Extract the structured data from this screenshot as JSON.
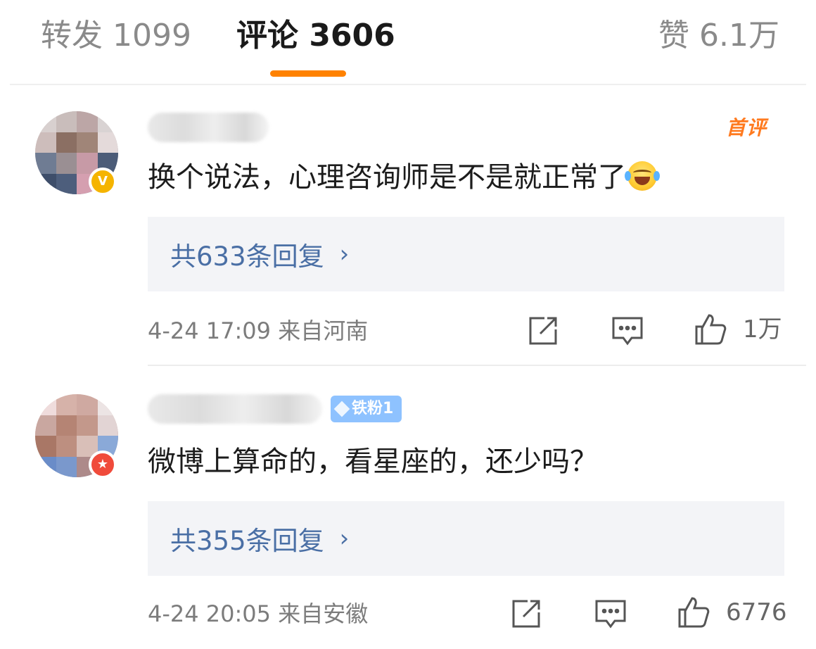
{
  "tabs": {
    "repost": "转发 1099",
    "comment": "评论 3606",
    "like": "赞 6.1万",
    "accent_color": "#ff8200"
  },
  "comments": [
    {
      "badge": "V",
      "tag": "首评",
      "text": "换个说法，心理咨询师是不是就正常了",
      "emoji": "laughing-tears-emoji",
      "replies": "共633条回复",
      "meta": "4-24 17:09 来自河南",
      "likes": "1万"
    },
    {
      "badge": "★",
      "fan_tag": "铁粉1",
      "text": "微博上算命的，看星座的，还少吗？",
      "replies": "共355条回复",
      "meta": "4-24 20:05 来自安徽",
      "likes": "6776"
    }
  ],
  "ui": {
    "chevron": "›"
  }
}
